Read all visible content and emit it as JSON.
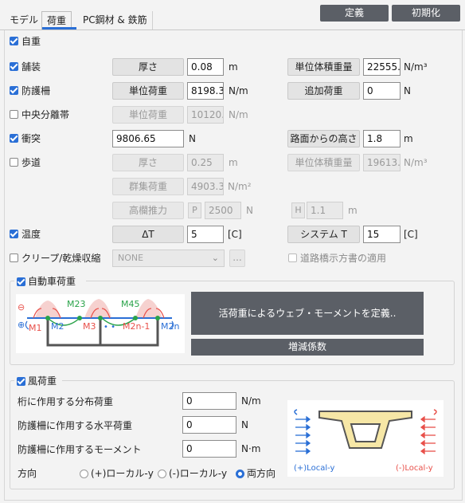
{
  "tabs": [
    "モデル",
    "荷重",
    "PC鋼材 & 鉄筋"
  ],
  "top_buttons": {
    "define": "定義",
    "init": "初期化"
  },
  "rows": {
    "self_weight": {
      "label": "自重"
    },
    "pavement": {
      "label": "舗装",
      "btn1": "厚さ",
      "val1": "0.08",
      "unit1": "m",
      "btn2": "単位体積重量",
      "val2": "22555.",
      "unit2": "N/m³"
    },
    "barrier": {
      "label": "防護柵",
      "btn1": "単位荷重",
      "val1": "8198.3",
      "unit1": "N/m",
      "btn2": "追加荷重",
      "val2": "0",
      "unit2": "N"
    },
    "median": {
      "label": "中央分離帯",
      "btn1": "単位荷重",
      "val1": "10120.",
      "unit1": "N/m"
    },
    "collision": {
      "label": "衝突",
      "val1": "9806.65",
      "unit1": "N",
      "btn2": "路面からの高さ",
      "val2": "1.8",
      "unit2": "m"
    },
    "sidewalk": {
      "label": "歩道",
      "btn1": "厚さ",
      "val1": "0.25",
      "unit1": "m",
      "btn2": "単位体積重量",
      "val2": "19613.",
      "unit2": "N/m³",
      "crowd_btn": "群集荷重",
      "crowd_val": "4903.3",
      "crowd_unit": "N/m²",
      "rail_btn": "高欄推力",
      "p_label": "P",
      "p_val": "2500",
      "p_unit": "N",
      "h_label": "H",
      "h_val": "1.1",
      "h_unit": "m"
    },
    "temperature": {
      "label": "温度",
      "btn1": "ΔT",
      "val1": "5",
      "unit1": "[C]",
      "btn2": "システム T",
      "val2": "15",
      "unit2": "[C]"
    },
    "creep": {
      "label": "クリープ/乾燥収縮",
      "dropdown": "NONE",
      "dots": "...",
      "check_label": "道路橋示方書の適用"
    }
  },
  "vehicle": {
    "title": "自動車荷重",
    "define_btn": "活荷重によるウェブ・モーメントを定義..",
    "factor_btn": "増減係数",
    "diagram": {
      "m23": "M23",
      "m45": "M45",
      "m1": "M1",
      "m2": "M2",
      "m3": "M3",
      "m2n1": "M2n-1",
      "m2n": "M2n",
      "minus": "⊖",
      "plus": "⊕",
      "dots": "• •"
    }
  },
  "wind": {
    "title": "風荷重",
    "rows": [
      {
        "label": "桁に作用する分布荷重",
        "value": "0",
        "unit": "N/m"
      },
      {
        "label": "防護柵に作用する水平荷重",
        "value": "0",
        "unit": "N"
      },
      {
        "label": "防護柵に作用するモーメント",
        "value": "0",
        "unit": "N·m"
      }
    ],
    "direction_label": "方向",
    "options": [
      "(+)ローカル-y",
      "(-)ローカル-y",
      "両方向"
    ],
    "selected": 2,
    "diagram": {
      "left": "(+)Local-y",
      "right": "(-)Local-y"
    }
  },
  "colors": {
    "accent": "#2a6fd6",
    "dark_button": "#5b5f66",
    "red": "#e8504a",
    "green": "#2aa34a"
  }
}
